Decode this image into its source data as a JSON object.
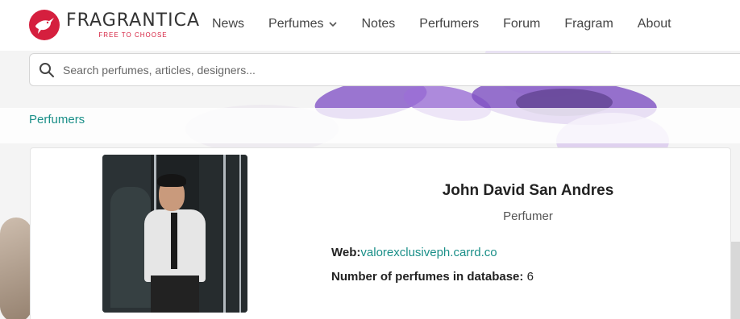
{
  "brand": {
    "name": "FRAGRANTICA",
    "tagline": "FREE TO CHOOSE",
    "color": "#d51f3e"
  },
  "nav": {
    "items": [
      {
        "label": "News"
      },
      {
        "label": "Perfumes",
        "has_dropdown": true,
        "icon": "chevron-down-icon"
      },
      {
        "label": "Notes"
      },
      {
        "label": "Perfumers"
      },
      {
        "label": "Forum"
      },
      {
        "label": "Fragram"
      },
      {
        "label": "About"
      }
    ]
  },
  "search": {
    "placeholder": "Search perfumes, articles, designers...",
    "value": "",
    "icon": "search-icon"
  },
  "breadcrumb": {
    "label": "Perfumers",
    "color": "#1a8f88"
  },
  "perfumer": {
    "name": "John David San Andres",
    "role": "Perfumer",
    "web_label": "Web:",
    "web_link": "valorexclusiveph.carrd.co",
    "count_label": "Number of perfumes in database:",
    "count_value": "6"
  }
}
